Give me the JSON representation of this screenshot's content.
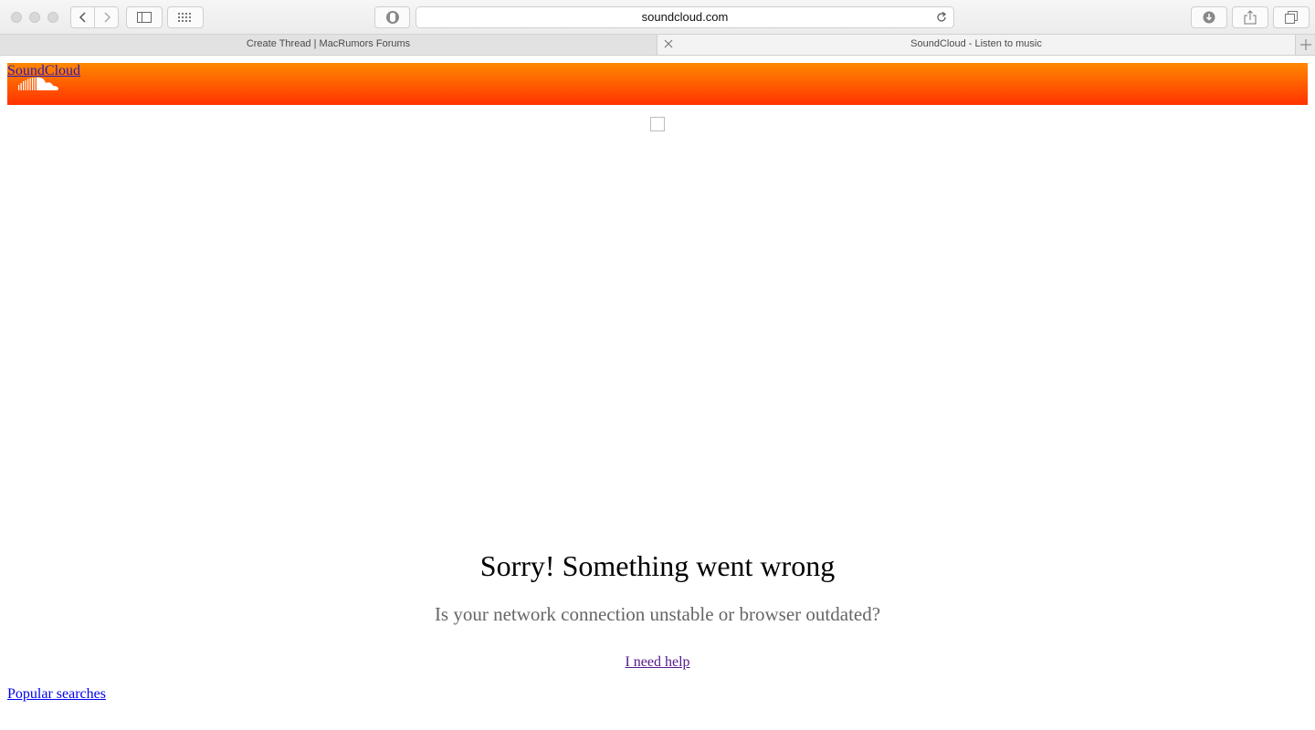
{
  "browser": {
    "address": "soundcloud.com",
    "tabs": [
      {
        "title": "Create Thread | MacRumors Forums",
        "active": false
      },
      {
        "title": "SoundCloud - Listen to music",
        "active": true
      }
    ],
    "icons": {
      "back": "chevron-left-icon",
      "forward": "chevron-right-icon",
      "sidebar": "sidebar-icon",
      "top_sites": "grid-icon",
      "privacy": "shield-icon",
      "reload": "reload-icon",
      "downloads": "download-icon",
      "share": "share-icon",
      "tabs_overview": "tabs-icon",
      "close_tab": "close-icon",
      "new_tab": "plus-icon"
    }
  },
  "header": {
    "logo_text": "SoundCloud",
    "gradient_top": "#ff8800",
    "gradient_bottom": "#ff3300"
  },
  "error": {
    "title": "Sorry! Something went wrong",
    "subtitle": "Is your network connection unstable or browser outdated?",
    "help_link": "I need help"
  },
  "footer": {
    "popular_searches": "Popular searches"
  }
}
